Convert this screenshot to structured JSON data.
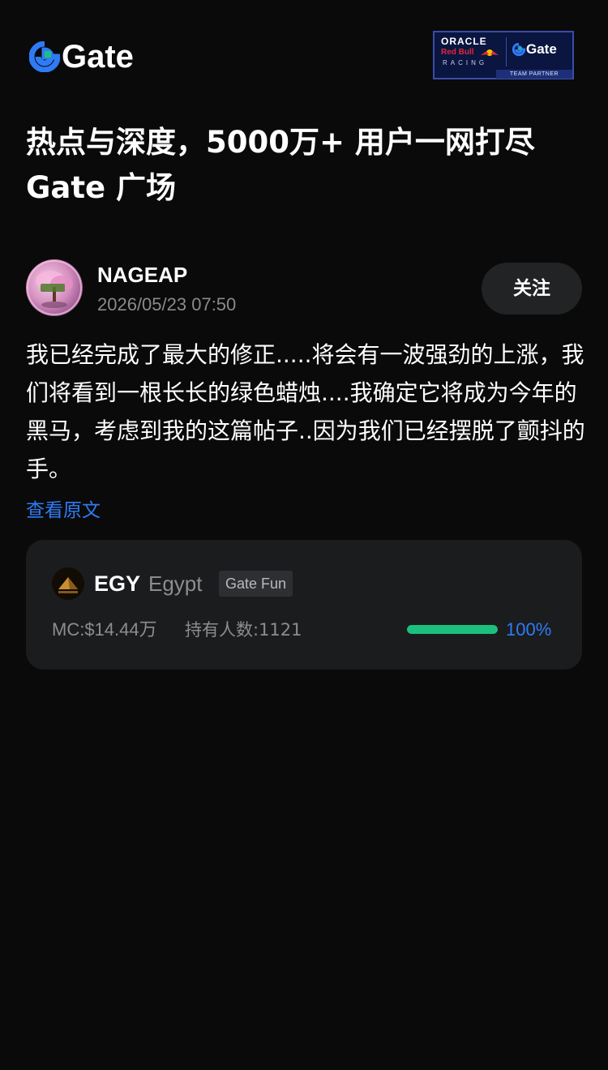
{
  "header": {
    "logo_text": "Gate",
    "partner_badge": {
      "line1": "ORACLE",
      "line2": "Red Bull",
      "line3": "RACING",
      "gate_text": "Gate",
      "team_label": "TEAM PARTNER"
    }
  },
  "headline": "热点与深度，5000万+ 用户一网打尽 Gate 广场",
  "post": {
    "author": {
      "name": "NAGEAP",
      "date": "2026/05/23 07:50",
      "follow_label": "关注"
    },
    "body": "我已经完成了最大的修正.....将会有一波强劲的上涨，我们将看到一根长长的绿色蜡烛....我确定它将成为今年的黑马，考虑到我的这篇帖子..因为我们已经摆脱了颤抖的手。",
    "view_original_label": "查看原文"
  },
  "token_card": {
    "symbol": "EGY",
    "name": "Egypt",
    "tag": "Gate Fun",
    "market_cap": "MC:$14.44万",
    "holders": "持有人数:1121",
    "progress": 1.0,
    "progress_label": "100%"
  },
  "colors": {
    "background": "#0a0a0a",
    "card": "#1b1c1e",
    "accent_blue": "#2f7bf6",
    "progress_green": "#1cc07e",
    "muted_text": "#8d8d8d"
  }
}
